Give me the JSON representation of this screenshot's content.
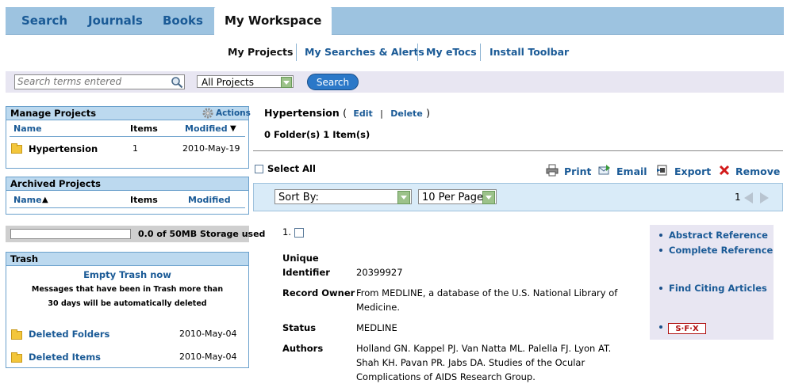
{
  "top_nav": {
    "tabs": [
      {
        "label": "Search"
      },
      {
        "label": "Journals"
      },
      {
        "label": "Books"
      },
      {
        "label": "My Workspace",
        "active": true
      }
    ]
  },
  "sub_nav": {
    "items": [
      {
        "label": "My Projects",
        "selected": true
      },
      {
        "label": "My Searches & Alerts"
      },
      {
        "label": "My eTocs"
      },
      {
        "label": "Install Toolbar"
      }
    ]
  },
  "search": {
    "placeholder": "Search terms entered",
    "scope_value": "All Projects",
    "button_label": "Search"
  },
  "manage_projects": {
    "title": "Manage Projects",
    "actions_label": "Actions",
    "col_name": "Name",
    "col_items": "Items",
    "col_modified": "Modified",
    "sort_indicator": "▼",
    "rows": [
      {
        "name": "Hypertension",
        "items": "1",
        "modified": "2010-May-19"
      }
    ]
  },
  "archived_projects": {
    "title": "Archived Projects",
    "col_name": "Name",
    "sort_indicator": "▲",
    "col_items": "Items",
    "col_modified": "Modified"
  },
  "storage": {
    "text": "0.0 of 50MB Storage used",
    "used_fraction": 0.0
  },
  "trash": {
    "title": "Trash",
    "empty_label": "Empty Trash now",
    "note_line1": "Messages that have been in Trash more than",
    "note_line2": "30 days will be automatically deleted",
    "rows": [
      {
        "name": "Deleted Folders",
        "modified": "2010-May-04"
      },
      {
        "name": "Deleted Items",
        "modified": "2010-May-04"
      }
    ]
  },
  "project": {
    "title": "Hypertension",
    "open_paren": "(",
    "edit_label": "Edit",
    "separator": "|",
    "delete_label": "Delete",
    "close_paren": ")",
    "summary": "0 Folder(s) 1 Item(s)"
  },
  "toolbar": {
    "select_all_label": "Select All",
    "print_label": "Print",
    "email_label": "Email",
    "export_label": "Export",
    "remove_label": "Remove"
  },
  "list_controls": {
    "sort_value": "Sort By:",
    "per_page_value": "10 Per Page",
    "page_number": "1"
  },
  "record": {
    "index": "1.",
    "fields": [
      {
        "label_line1": "Unique",
        "label_line2": "Identifier",
        "value": "20399927"
      },
      {
        "label": "Record Owner",
        "value": "From MEDLINE, a database of the U.S. National Library of Medicine."
      },
      {
        "label": "Status",
        "value": "MEDLINE"
      },
      {
        "label": "Authors",
        "value": "Holland GN. Kappel PJ. Van Natta ML. Palella FJ. Lyon AT. Shah KH. Pavan PR. Jabs DA. Studies of the Ocular Complications of AIDS Research Group."
      }
    ]
  },
  "side_links": {
    "abstract": "Abstract Reference",
    "complete": "Complete Reference",
    "citing": "Find Citing Articles",
    "sfx": "S·F·X"
  },
  "colors": {
    "nav_bar": "#9dc3e0",
    "link": "#1a5a96",
    "panel_header": "#bcd9ef",
    "search_button": "#2b78c8",
    "remove_icon": "#d21a1a"
  }
}
